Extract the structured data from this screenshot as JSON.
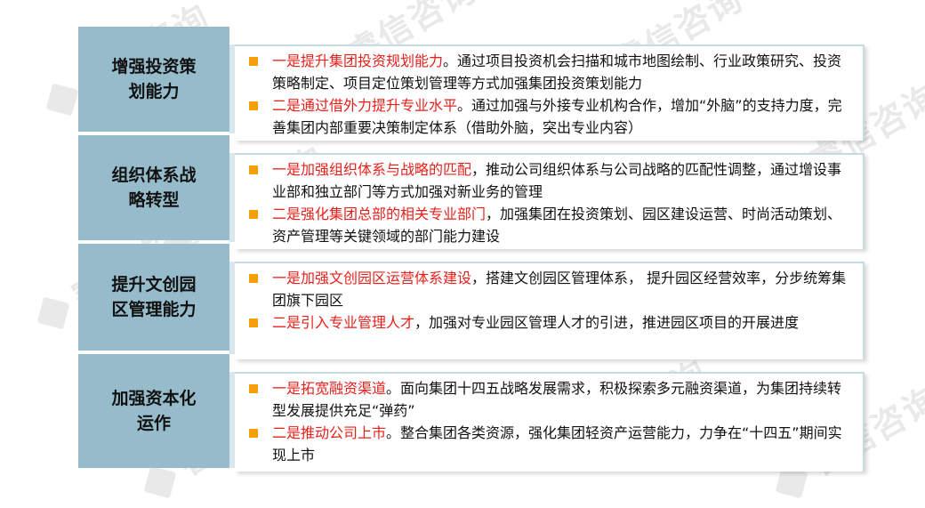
{
  "watermark": {
    "text": "睿信咨询"
  },
  "colors": {
    "label_bg": "#96bccb",
    "bullet": "#f5a00a",
    "highlight": "#e8201b",
    "text": "#111111"
  },
  "sections": [
    {
      "label": "增强投资策划能力",
      "items": [
        {
          "highlight": "一是提升集团投资规划能力",
          "text": "。通过项目投资机会扫描和城市地图绘制、行业政策研究、投资策略制定、项目定位策划管理等方式加强集团投资策划能力"
        },
        {
          "highlight": "二是通过借外力提升专业水平",
          "text": "。通过加强与外接专业机构合作，增加“外脑”的支持力度，完善集团内部重要决策制定体系（借助外脑，突出专业内容）"
        }
      ]
    },
    {
      "label": "组织体系战略转型",
      "items": [
        {
          "highlight": "一是加强组织体系与战略的匹配",
          "text": "，推动公司组织体系与公司战略的匹配性调整，通过增设事业部和独立部门等方式加强对新业务的管理"
        },
        {
          "highlight": "二是强化集团总部的相关专业部门",
          "text": "，加强集团在投资策划、园区建设运营、时尚活动策划、资产管理等关键领域的部门能力建设"
        }
      ]
    },
    {
      "label": "提升文创园区管理能力",
      "items": [
        {
          "highlight": "一是加强文创园区运营体系建设",
          "text": "，搭建文创园区管理体系， 提升园区经营效率，分步统筹集团旗下园区"
        },
        {
          "highlight": "二是引入专业管理人才",
          "text": "，加强对专业园区管理人才的引进，推进园区项目的开展进度"
        }
      ]
    },
    {
      "label": "加强资本化运作",
      "items": [
        {
          "highlight": "一是拓宽融资渠道",
          "text": "。面向集团十四五战略发展需求，积极探索多元融资渠道，为集团持续转型发展提供充足“弹药”"
        },
        {
          "highlight": "二是推动公司上市",
          "text": "。整合集团各类资源，强化集团轻资产运营能力，力争在“十四五”期间实现上市"
        }
      ]
    }
  ]
}
